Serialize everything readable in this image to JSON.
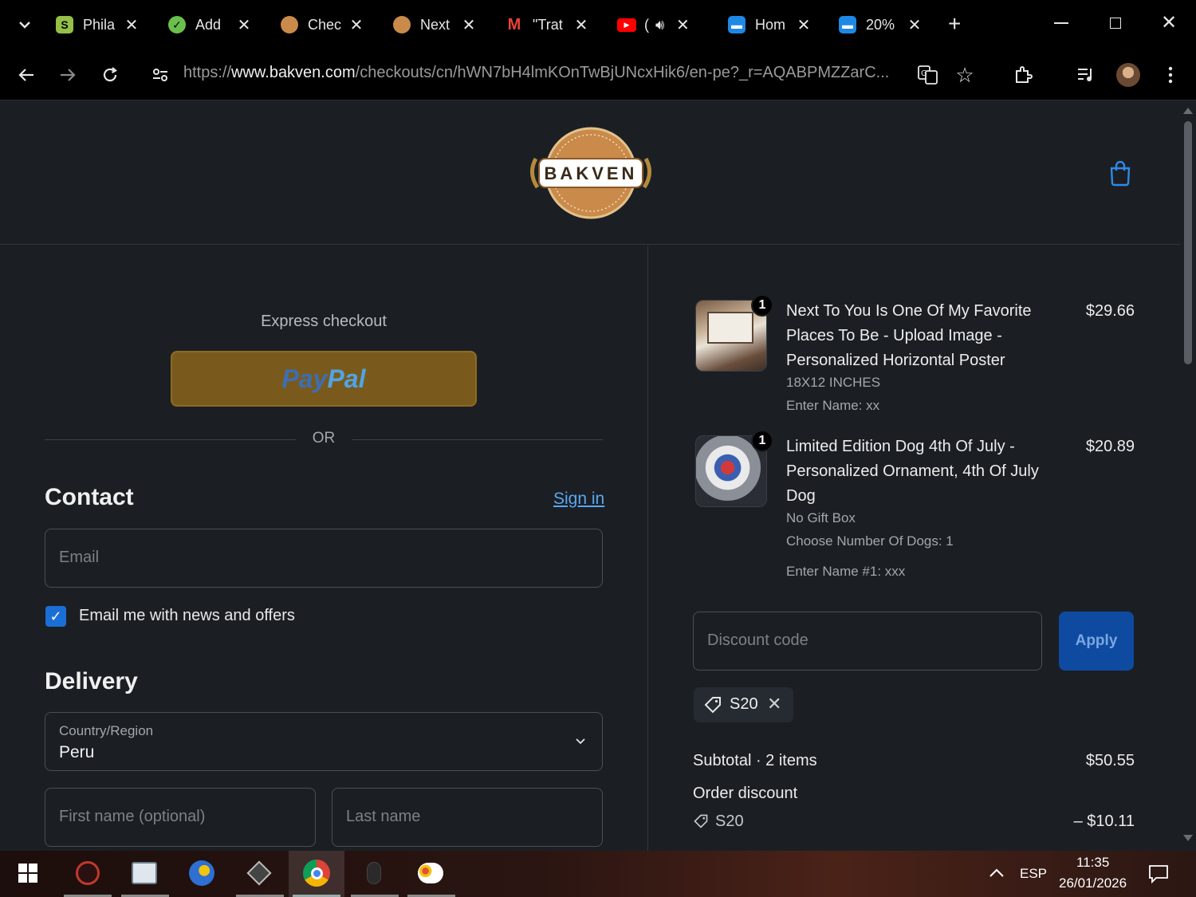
{
  "browser": {
    "tabs": [
      {
        "label": "Phila",
        "icon": "shopify-icon",
        "color": "#95bf47"
      },
      {
        "label": "Add",
        "icon": "app-icon",
        "color": "#6ac04c"
      },
      {
        "label": "Chec",
        "icon": "bakven-icon",
        "color": "#c98a4a"
      },
      {
        "label": "Next",
        "icon": "bakven-icon",
        "color": "#c98a4a"
      },
      {
        "label": "\"Trat",
        "icon": "gmail-icon",
        "color": "#ea4335"
      },
      {
        "label": "(",
        "icon": "youtube-icon",
        "color": "#ff0000"
      },
      {
        "label": "Hom",
        "icon": "chat-icon",
        "color": "#1e88e5"
      },
      {
        "label": "20%",
        "icon": "chat-icon",
        "color": "#1e88e5"
      }
    ],
    "new_tab": "+",
    "url_prefix": "https://",
    "url_host": "www.bakven.com",
    "url_path": "/checkouts/cn/hWN7bH4lmKOnTwBjUNcxHik6/en-pe?_r=AQABPMZZarC..."
  },
  "store": {
    "logo_text": "BAKVEN"
  },
  "checkout": {
    "express_label": "Express checkout",
    "paypal_a": "Pay",
    "paypal_b": "Pal",
    "or_label": "OR",
    "contact_title": "Contact",
    "sign_in": "Sign in",
    "email_placeholder": "Email",
    "newsletter_label": "Email me with news and offers",
    "newsletter_checked": true,
    "delivery_title": "Delivery",
    "country_label": "Country/Region",
    "country_value": "Peru",
    "first_name_placeholder": "First name (optional)",
    "last_name_placeholder": "Last name"
  },
  "order": {
    "items": [
      {
        "qty": "1",
        "title": "Next To You Is One Of My Favorite Places To Be - Upload Image - Personalized Horizontal Poster",
        "price": "$29.66",
        "options": [
          "18X12 INCHES",
          "Enter Name: xx"
        ]
      },
      {
        "qty": "1",
        "title": "Limited Edition Dog 4th Of July - Personalized Ornament, 4th Of July Dog",
        "price": "$20.89",
        "options": [
          "No Gift Box",
          "Choose Number Of Dogs: 1",
          "Enter Name #1: xxx"
        ]
      }
    ],
    "discount_placeholder": "Discount code",
    "apply_label": "Apply",
    "applied_code": "S20",
    "subtotal_label": "Subtotal · 2 items",
    "subtotal_value": "$50.55",
    "order_discount_label": "Order discount",
    "discount_code_label": "S20",
    "discount_value": "– $10.11"
  },
  "taskbar": {
    "language": "ESP",
    "time": "11:35",
    "date": "26/01/2026"
  }
}
